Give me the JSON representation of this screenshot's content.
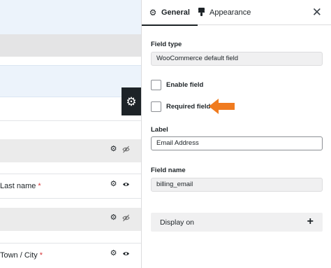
{
  "builder": {
    "rows": [
      {
        "label": "Last name",
        "required_mark": "*",
        "icons": [
          "gear-icon",
          "eye-icon"
        ]
      },
      {
        "label": "Town / City",
        "required_mark": "*",
        "icons": [
          "gear-icon",
          "eye-icon"
        ]
      }
    ],
    "collapsed_row_icons": [
      "gear-icon",
      "eye-slash-icon"
    ]
  },
  "panel": {
    "tabs": [
      {
        "label": "General",
        "icon": "gear-icon"
      },
      {
        "label": "Appearance",
        "icon": "paint-brush-icon"
      }
    ],
    "close_icon": "close-icon",
    "field_type": {
      "label": "Field type",
      "value": "WooCommerce default field"
    },
    "enable_field": {
      "label": "Enable field",
      "checked": false
    },
    "required_field": {
      "label": "Required field",
      "checked": false
    },
    "label_field": {
      "label": "Label",
      "value": "Email Address"
    },
    "field_name": {
      "label": "Field name",
      "value": "billing_email"
    },
    "display_on": {
      "label": "Display on",
      "icon": "plus-icon"
    }
  },
  "colors": {
    "accent_arrow": "#f07b1f",
    "required": "#d63638",
    "dark": "#1d2327"
  }
}
